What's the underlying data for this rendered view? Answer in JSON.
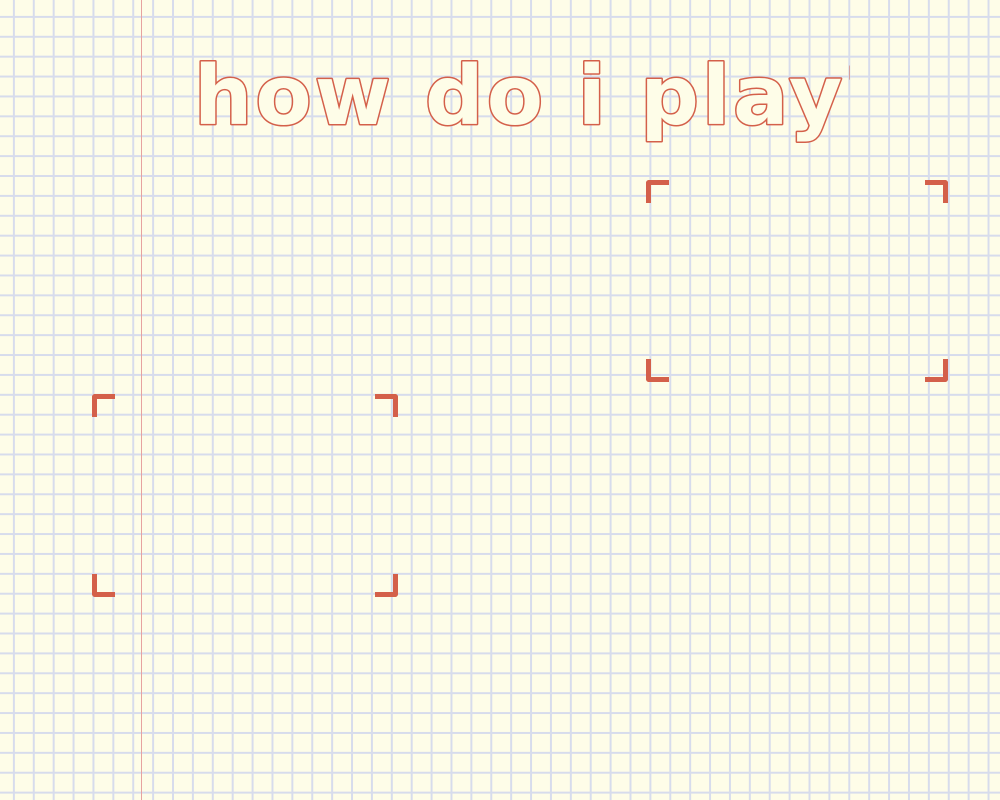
{
  "page": {
    "title": "how do i play?"
  },
  "colors": {
    "paper": "#fefde8",
    "grid": "#d7dcec",
    "margin_line": "#e7a3a0",
    "accent": "#d4604a"
  },
  "frames": [
    {
      "name": "left-frame",
      "content": ""
    },
    {
      "name": "right-frame",
      "content": ""
    }
  ]
}
